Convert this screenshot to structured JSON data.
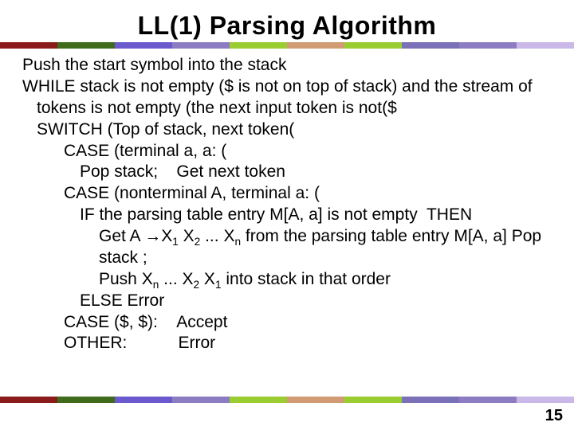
{
  "title": "LL(1) Parsing Algorithm",
  "lines": {
    "l0": "Push the start symbol into the stack",
    "l1": "WHILE stack is not empty ($ is not on top of stack) and the stream of tokens is not empty (the next input token is not($",
    "l2": "SWITCH (Top of stack, next token(",
    "l3": "CASE (terminal a, a: (",
    "l4": "Pop stack;    Get next token",
    "l5": "CASE (nonterminal A, terminal a: (",
    "l6": "IF the parsing table entry M[A, a] is not empty  THEN",
    "l7a": "Get A ",
    "l7b": "X",
    "l7c": " X",
    "l7d": " ... X",
    "l7e": " from the parsing table entry M[A, a] Pop stack ;",
    "l8a": "Push X",
    "l8b": " ... X",
    "l8c": " X",
    "l8d": " into stack in that order",
    "l9": "ELSE Error",
    "l10": "CASE ($, $):    Accept",
    "l11": "OTHER:           Error"
  },
  "subs": {
    "one": "1",
    "two": "2",
    "n": "n"
  },
  "arrow": "→",
  "page": "15",
  "chart_data": {
    "type": "table",
    "title": "LL(1) Parsing Algorithm pseudocode",
    "rows": [
      "Push the start symbol into the stack",
      "WHILE stack is not empty ($ is not on top of stack) and the stream of tokens is not empty (the next input token is not($",
      "  SWITCH (Top of stack, next token(",
      "    CASE (terminal a, a:(",
      "      Pop stack;    Get next token",
      "    CASE (nonterminal A, terminal a:(",
      "      IF the parsing table entry M[A, a] is not empty  THEN",
      "        Get A → X1 X2 ... Xn from the parsing table entry M[A, a] Pop stack ;",
      "        Push Xn ... X2 X1 into stack in that order",
      "      ELSE Error",
      "    CASE ($, $):    Accept",
      "    OTHER:          Error"
    ]
  }
}
